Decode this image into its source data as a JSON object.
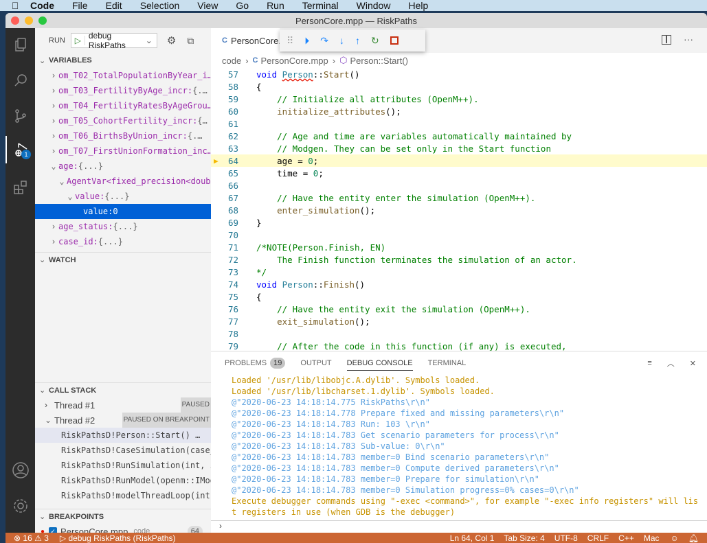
{
  "menubar": {
    "apple": "",
    "items": [
      "Code",
      "File",
      "Edit",
      "Selection",
      "View",
      "Go",
      "Run",
      "Terminal",
      "Window",
      "Help"
    ]
  },
  "window": {
    "title": "PersonCore.mpp — RiskPaths"
  },
  "activity": {
    "items": [
      "explorer-icon",
      "search-icon",
      "source-control-icon",
      "run-debug-icon",
      "extensions-icon"
    ],
    "debug_badge": "1"
  },
  "run": {
    "label": "RUN",
    "config": "debug RiskPaths"
  },
  "variables": {
    "title": "VARIABLES",
    "rows": [
      {
        "name": "om_T02_TotalPopulationByYear_i…",
        "value": "",
        "indent": 0,
        "twisty": "›"
      },
      {
        "name": "om_T03_FertilityByAge_incr:",
        "value": " {.…",
        "indent": 0,
        "twisty": "›"
      },
      {
        "name": "om_T04_FertilityRatesByAgeGrou…",
        "value": "",
        "indent": 0,
        "twisty": "›"
      },
      {
        "name": "om_T05_CohortFertility_incr:",
        "value": " {…",
        "indent": 0,
        "twisty": "›"
      },
      {
        "name": "om_T06_BirthsByUnion_incr:",
        "value": " {.…",
        "indent": 0,
        "twisty": "›"
      },
      {
        "name": "om_T07_FirstUnionFormation_inc…",
        "value": "",
        "indent": 0,
        "twisty": "›"
      },
      {
        "name": "age:",
        "value": " {...}",
        "indent": 0,
        "twisty": "⌄"
      },
      {
        "name": "AgentVar<fixed_precision<doub…",
        "value": "",
        "indent": 1,
        "twisty": "⌄"
      },
      {
        "name": "value:",
        "value": " {...}",
        "indent": 2,
        "twisty": "⌄"
      },
      {
        "name": "value:",
        "value": " 0",
        "indent": 3,
        "twisty": "",
        "selected": true
      },
      {
        "name": "age_status:",
        "value": " {...}",
        "indent": 0,
        "twisty": "›"
      },
      {
        "name": "case_id:",
        "value": " {...}",
        "indent": 0,
        "twisty": "›"
      }
    ]
  },
  "watch": {
    "title": "WATCH"
  },
  "callstack": {
    "title": "CALL STACK",
    "threads": [
      {
        "name": "Thread #1",
        "status": "PAUSED"
      },
      {
        "name": "Thread #2",
        "status": "PAUSED ON BREAKPOINT"
      }
    ],
    "frames": [
      "RiskPathsD!Person::Start()  …",
      "RiskPathsD!CaseSimulation(case_in",
      "RiskPathsD!RunSimulation(int, int",
      "RiskPathsD!RunModel(openm::IModel",
      "RiskPathsD!modelThreadLoop(int, i"
    ]
  },
  "breakpoints": {
    "title": "BREAKPOINTS",
    "items": [
      {
        "file": "PersonCore.mpp",
        "folder": "code",
        "line": "64"
      }
    ]
  },
  "editor": {
    "tab": "PersonCore.mpp",
    "breadcrumb": [
      "code",
      "PersonCore.mpp",
      "Person::Start()"
    ],
    "current_line": 64
  },
  "console": {
    "tabs": [
      "PROBLEMS",
      "OUTPUT",
      "DEBUG CONSOLE",
      "TERMINAL"
    ],
    "problems_count": "19",
    "active": "DEBUG CONSOLE",
    "lines": [
      {
        "c": "o",
        "t": "Loaded '/usr/lib/libobjc.A.dylib'. Symbols loaded."
      },
      {
        "c": "o",
        "t": "Loaded '/usr/lib/libcharset.1.dylib'. Symbols loaded."
      },
      {
        "c": "b",
        "t": "@\"2020-06-23 14:18:14.775 RiskPaths\\r\\n\""
      },
      {
        "c": "b",
        "t": "@\"2020-06-23 14:18:14.778 Prepare fixed and missing parameters\\r\\n\""
      },
      {
        "c": "b",
        "t": "@\"2020-06-23 14:18:14.783 Run: 103 \\r\\n\""
      },
      {
        "c": "b",
        "t": "@\"2020-06-23 14:18:14.783 Get scenario parameters for process\\r\\n\""
      },
      {
        "c": "b",
        "t": "@\"2020-06-23 14:18:14.783 Sub-value: 0\\r\\n\""
      },
      {
        "c": "b",
        "t": "@\"2020-06-23 14:18:14.783 member=0 Bind scenario parameters\\r\\n\""
      },
      {
        "c": "b",
        "t": "@\"2020-06-23 14:18:14.783 member=0 Compute derived parameters\\r\\n\""
      },
      {
        "c": "b",
        "t": "@\"2020-06-23 14:18:14.783 member=0 Prepare for simulation\\r\\n\""
      },
      {
        "c": "b",
        "t": "@\"2020-06-23 14:18:14.783 member=0 Simulation progress=0% cases=0\\r\\n\""
      },
      {
        "c": "o",
        "t": "Execute debugger commands using \"-exec <command>\", for example \"-exec info registers\" will lis"
      },
      {
        "c": "o",
        "t": "t registers in use (when GDB is the debugger)"
      }
    ],
    "prompt": "›"
  },
  "status": {
    "errors": "16",
    "warnings": "3",
    "debug": "debug RiskPaths (RiskPaths)",
    "position": "Ln 64, Col 1",
    "tab_size": "Tab Size: 4",
    "encoding": "UTF-8",
    "eol": "CRLF",
    "language": "C++",
    "platform": "Mac"
  }
}
